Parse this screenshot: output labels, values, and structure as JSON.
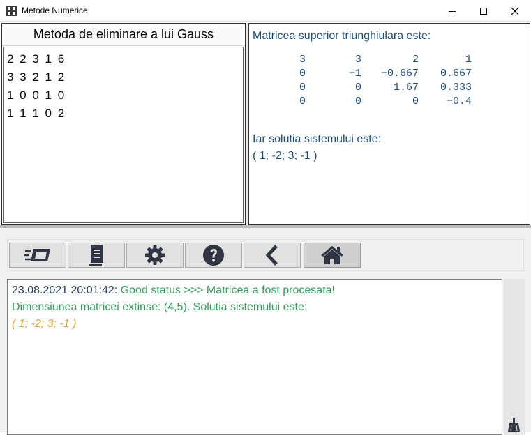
{
  "window": {
    "title": "Metode Numerice"
  },
  "left_panel": {
    "title": "Metoda de eliminare a lui Gauss",
    "input_lines": [
      "2 2 3 1 6",
      "3 3 2 1 2",
      "1 0 0 1 0",
      "1 1 1 0 2"
    ]
  },
  "right_panel": {
    "heading": "Matricea superior triunghiulara este:",
    "matrix": [
      [
        "3",
        "3",
        "2",
        "1"
      ],
      [
        "0",
        "−1",
        "−0.667",
        "0.667"
      ],
      [
        "0",
        "0",
        "1.67",
        "0.333"
      ],
      [
        "0",
        "0",
        "0",
        "−0.4"
      ]
    ],
    "solution_label": "Iar solutia sistemului este:",
    "solution_value": "( 1; -2; 3; -1 )"
  },
  "toolbar": {
    "buttons": [
      {
        "icon": "fast-forward-card-icon",
        "active": false
      },
      {
        "icon": "document-icon",
        "active": false
      },
      {
        "icon": "gear-icon",
        "active": false
      },
      {
        "icon": "help-icon",
        "active": false
      },
      {
        "icon": "chevron-left-icon",
        "active": false
      },
      {
        "icon": "home-icon",
        "active": true
      }
    ]
  },
  "log": {
    "timestamp": "23.08.2021 20:01:42:",
    "status": "Good status >>> Matricea a fost procesata!",
    "line2": "Dimensiunea matricei extinse: (4,5). Solutia sistemului este:",
    "line3": "( 1; -2; 3; -1 )"
  },
  "colors": {
    "heading_text": "#1f4e79",
    "log_ok": "#2e9e5b",
    "log_solution": "#e0a020"
  }
}
